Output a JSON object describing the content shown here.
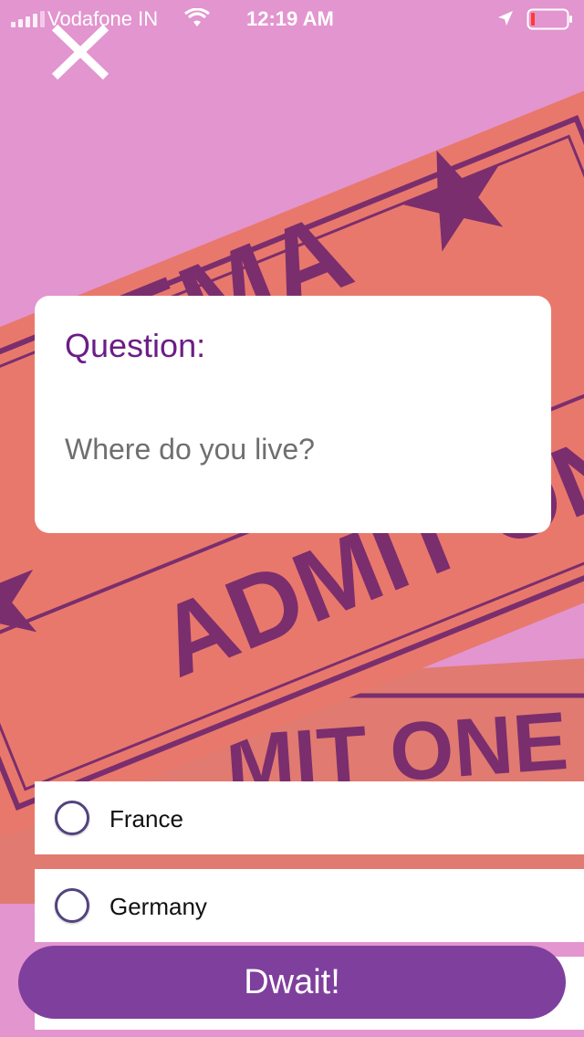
{
  "status_bar": {
    "carrier": "Vodafone IN",
    "time": "12:19 AM"
  },
  "background": {
    "ticket_top_text": "EMA",
    "ticket_mid_text": "ADMIT ONE",
    "ticket_low_text": "MIT ONE"
  },
  "question": {
    "label": "Question:",
    "text": "Where do you live?"
  },
  "options": [
    {
      "label": "France",
      "selected": false
    },
    {
      "label": "Germany",
      "selected": false
    }
  ],
  "submit": {
    "label": "Dwait!"
  },
  "colors": {
    "background": "#e295cf",
    "ticket": "#e9786c",
    "ticket_ink": "#7a2e6e",
    "accent": "#7f3f9d",
    "question_label": "#6c1d86",
    "radio_border": "#53437e"
  }
}
